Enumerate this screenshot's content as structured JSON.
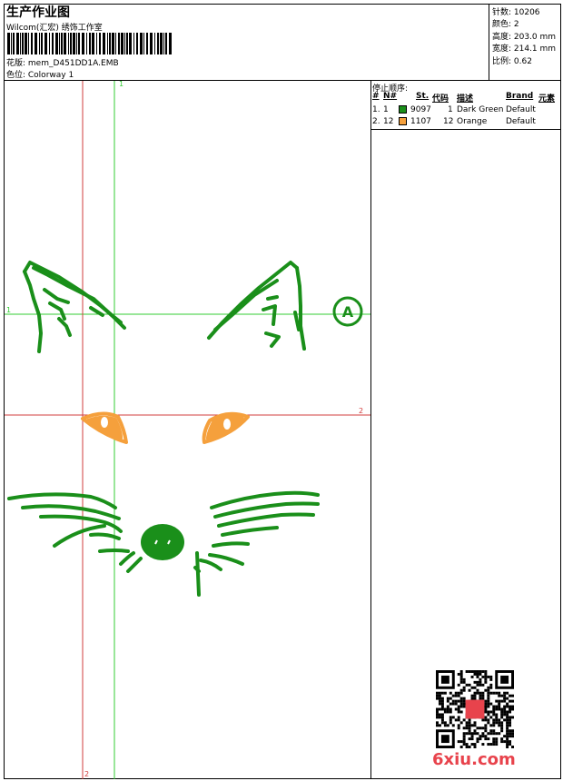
{
  "header": {
    "title": "生产作业图",
    "software": "Wilcom(汇宏) 绣饰工作室",
    "design_line": "花版: mem_D451DD1A.EMB",
    "colorway_line": "色位: Colorway 1"
  },
  "meta": {
    "stitches": "针数: 10206",
    "colors": "颜色: 2",
    "height": "高度: 203.0 mm",
    "width": "宽度: 214.1 mm",
    "scale": "比例: 0.62"
  },
  "stop_sequence": {
    "label": "停止顺序:",
    "columns": {
      "num": "#",
      "n": "N#",
      "st": "St.",
      "code": "代码",
      "desc": "描述",
      "brand": "Brand",
      "elem": "元素"
    },
    "rows": [
      {
        "num": "1.",
        "n": "1",
        "st": "9097",
        "code": "1",
        "desc": "Dark Green",
        "brand": "Default",
        "color": "#1a8f1a"
      },
      {
        "num": "2.",
        "n": "12",
        "st": "1107",
        "code": "12",
        "desc": "Orange",
        "brand": "Default",
        "color": "#f5a03c"
      }
    ]
  },
  "guides": {
    "v_green": "1",
    "h_green": "1",
    "h_red": "2",
    "v_red": "2"
  },
  "start_marker": "A",
  "watermark": "6xiu.com",
  "colors": {
    "green": "#1a8f1a",
    "orange": "#f5a03c",
    "red_guide": "#d23c3c",
    "green_guide": "#33cc33"
  }
}
